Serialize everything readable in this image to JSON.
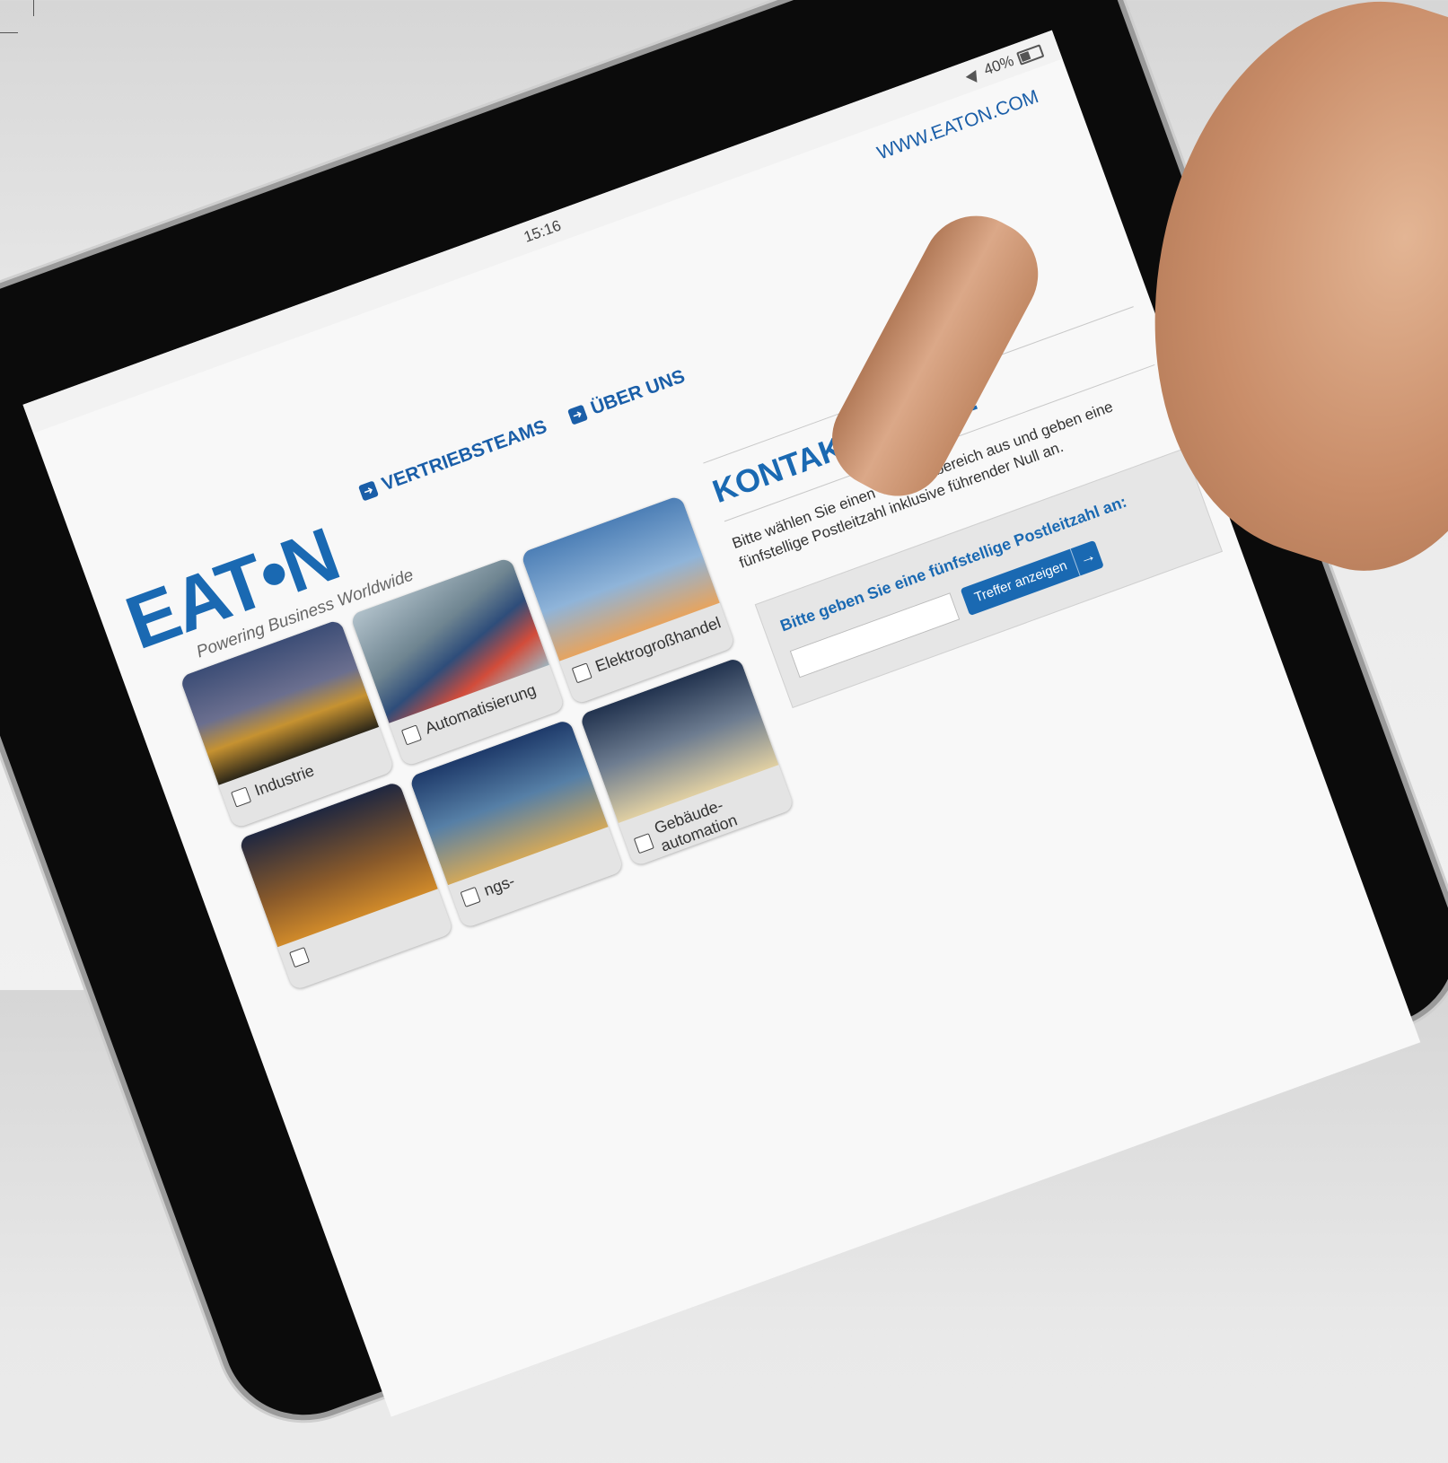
{
  "statusbar": {
    "time": "15:16",
    "battery": "40%"
  },
  "header": {
    "url": "WWW.EATON.COM"
  },
  "logo": {
    "brand": "EAT•N",
    "tagline": "Powering Business Worldwide"
  },
  "nav": {
    "items": [
      {
        "label": "VERTRIEBSTEAMS"
      },
      {
        "label": "ÜBER UNS"
      }
    ]
  },
  "tiles": [
    {
      "label": "Industrie"
    },
    {
      "label": "Automatisierung"
    },
    {
      "label": "Elektrogroßhandel"
    },
    {
      "label": ""
    },
    {
      "label": "ngs-"
    },
    {
      "label": "Gebäude-automation"
    }
  ],
  "contact": {
    "title": "KONTAKT-SUCHE",
    "description": "Bitte wählen Sie einen Vertriebsbereich aus und geben eine fünfstellige Postleitzahl inklusive führender Null an.",
    "zip_label": "Bitte geben Sie eine fünfstellige Postleitzahl an:",
    "zip_value": "",
    "submit_label": "Treffer anzeigen"
  },
  "colors": {
    "accent": "#1a69b2",
    "link": "#1a5ea8"
  }
}
